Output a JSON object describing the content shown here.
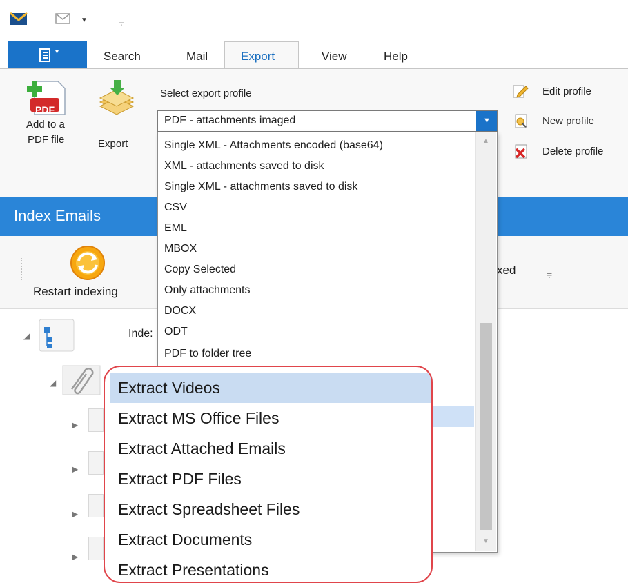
{
  "quick_access": {
    "icons": [
      "mail-app-icon",
      "mail-small-icon",
      "dropdown-arrow-icon",
      "customize-qat-icon"
    ]
  },
  "tabs": {
    "file_icon": "file-menu-icon",
    "items": [
      "Search",
      "Mail",
      "Export",
      "View",
      "Help"
    ],
    "active": "Export"
  },
  "ribbon": {
    "add_pdf": {
      "line1": "Add to a",
      "line2": "PDF file",
      "icon_text": "PDF"
    },
    "export_label": "Export",
    "select_profile_label": "Select export profile",
    "selected_profile": "PDF - attachments imaged",
    "edit_profile": "Edit profile",
    "new_profile": "New profile",
    "delete_profile": "Delete profile"
  },
  "panel": {
    "title": "Index Emails",
    "restart_indexing": "Restart indexing",
    "partial_indexed": "xed",
    "tree_label_partial": "Inde:"
  },
  "dropdown": {
    "items": [
      "Single XML - Attachments encoded (base64)",
      "XML - attachments saved to disk",
      "Single XML - attachments saved to disk",
      "CSV",
      "EML",
      "MBOX",
      "Copy Selected",
      "Only attachments",
      "DOCX",
      "ODT",
      "PDF to folder tree"
    ]
  },
  "callout": {
    "items": [
      "Extract Videos",
      "Extract MS Office Files",
      "Extract Attached Emails",
      "Extract PDF Files",
      "Extract Spreadsheet Files",
      "Extract Documents",
      "Extract Presentations"
    ],
    "highlighted": "Extract Videos",
    "border_color": "#e0454b"
  },
  "colors": {
    "accent": "#1a73c9",
    "header_blue": "#2a85d8",
    "highlight": "#cfe1f7"
  }
}
